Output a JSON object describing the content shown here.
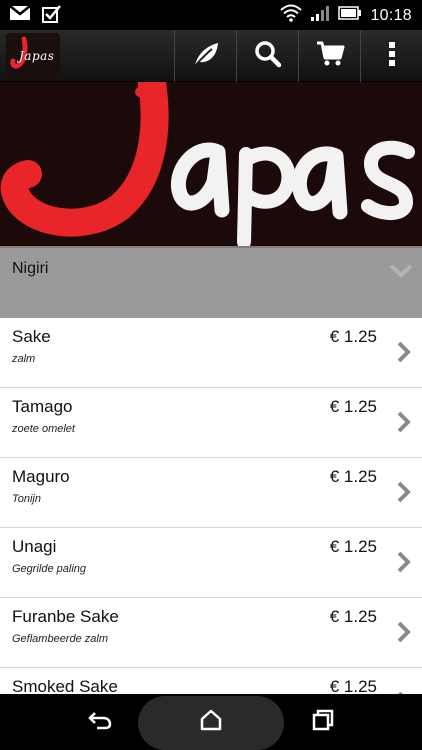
{
  "status_bar": {
    "time": "10:18",
    "left_icons": [
      "gmail-icon",
      "checkbox-icon"
    ],
    "right_icons": [
      "wifi-icon",
      "signal-icon",
      "battery-icon"
    ]
  },
  "app_bar": {
    "logo_text": "Japas",
    "actions": [
      "leaf-icon",
      "search-icon",
      "cart-icon",
      "overflow-menu-icon"
    ]
  },
  "banner": {
    "text": "apas"
  },
  "section": {
    "title": "Nigiri"
  },
  "items": [
    {
      "name": "Sake",
      "desc": "zalm",
      "price": "€ 1.25"
    },
    {
      "name": "Tamago",
      "desc": "zoete omelet",
      "price": "€ 1.25"
    },
    {
      "name": "Maguro",
      "desc": "Tonijn",
      "price": "€ 1.25"
    },
    {
      "name": "Unagi",
      "desc": "Gegrilde paling",
      "price": "€ 1.25"
    },
    {
      "name": "Furanbe Sake",
      "desc": "Geflambeerde zalm",
      "price": "€ 1.25"
    },
    {
      "name": "Smoked Sake",
      "desc": "",
      "price": "€ 1.25"
    }
  ],
  "colors": {
    "accent_red": "#e8262a",
    "section_grey": "#9a9a9a",
    "chevron_grey": "#8a8a8a"
  }
}
